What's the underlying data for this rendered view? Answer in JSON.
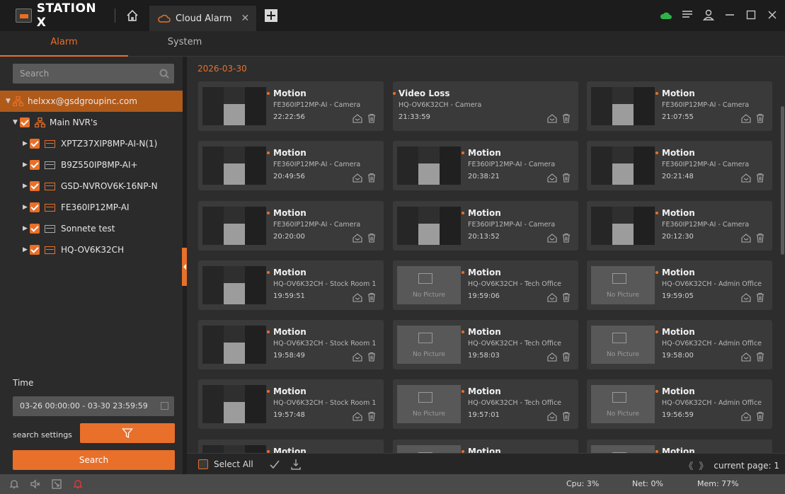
{
  "app": {
    "title": "STATION X"
  },
  "tabs": [
    {
      "label": "Cloud Alarm"
    }
  ],
  "subtabs": {
    "alarm": "Alarm",
    "system": "System"
  },
  "sidebar": {
    "search_placeholder": "Search",
    "tree": {
      "account": "helxxx@gsdgroupinc.com",
      "group": "Main NVR's",
      "devices": [
        "XPTZ37XIP8MP-AI-N(1)",
        "B9Z550IP8MP-AI+",
        "GSD-NVROV6K-16NP-N",
        "FE360IP12MP-AI",
        "Sonnete test",
        "HQ-OV6K32CH"
      ]
    },
    "time_label": "Time",
    "time_range": "03-26 00:00:00 - 03-30 23:59:59",
    "search_settings_label": "search settings",
    "search_button": "Search"
  },
  "main": {
    "date": "2026-03-30",
    "alarms": [
      {
        "type": "Motion",
        "device": "FE360IP12MP-AI - Camera",
        "time": "22:22:56",
        "picture": true
      },
      {
        "type": "Video Loss",
        "device": "HQ-OV6K32CH - Camera",
        "time": "21:33:59",
        "picture": false,
        "thumbnail": false
      },
      {
        "type": "Motion",
        "device": "FE360IP12MP-AI - Camera",
        "time": "21:07:55",
        "picture": true
      },
      {
        "type": "Motion",
        "device": "FE360IP12MP-AI - Camera",
        "time": "20:49:56",
        "picture": true
      },
      {
        "type": "Motion",
        "device": "FE360IP12MP-AI - Camera",
        "time": "20:38:21",
        "picture": true
      },
      {
        "type": "Motion",
        "device": "FE360IP12MP-AI - Camera",
        "time": "20:21:48",
        "picture": true
      },
      {
        "type": "Motion",
        "device": "FE360IP12MP-AI - Camera",
        "time": "20:20:00",
        "picture": true
      },
      {
        "type": "Motion",
        "device": "FE360IP12MP-AI - Camera",
        "time": "20:13:52",
        "picture": true
      },
      {
        "type": "Motion",
        "device": "FE360IP12MP-AI - Camera",
        "time": "20:12:30",
        "picture": true
      },
      {
        "type": "Motion",
        "device": "HQ-OV6K32CH - Stock Room 1",
        "time": "19:59:51",
        "picture": true
      },
      {
        "type": "Motion",
        "device": "HQ-OV6K32CH - Tech Office",
        "time": "19:59:06",
        "picture": false
      },
      {
        "type": "Motion",
        "device": "HQ-OV6K32CH - Admin Office",
        "time": "19:59:05",
        "picture": false
      },
      {
        "type": "Motion",
        "device": "HQ-OV6K32CH - Stock Room 1",
        "time": "19:58:49",
        "picture": true
      },
      {
        "type": "Motion",
        "device": "HQ-OV6K32CH - Tech Office",
        "time": "19:58:03",
        "picture": false
      },
      {
        "type": "Motion",
        "device": "HQ-OV6K32CH - Admin Office",
        "time": "19:58:00",
        "picture": false
      },
      {
        "type": "Motion",
        "device": "HQ-OV6K32CH - Stock Room 1",
        "time": "19:57:48",
        "picture": true
      },
      {
        "type": "Motion",
        "device": "HQ-OV6K32CH - Tech Office",
        "time": "19:57:01",
        "picture": false
      },
      {
        "type": "Motion",
        "device": "HQ-OV6K32CH - Admin Office",
        "time": "19:56:59",
        "picture": false
      },
      {
        "type": "Motion",
        "device": "",
        "time": "",
        "picture": true
      },
      {
        "type": "Motion",
        "device": "",
        "time": "",
        "picture": false
      },
      {
        "type": "Motion",
        "device": "",
        "time": "",
        "picture": false
      }
    ],
    "no_picture_text": "No Picture"
  },
  "actionbar": {
    "select_all": "Select All",
    "page_label": "current page: 1"
  },
  "status": {
    "cpu": "Cpu: 3%",
    "net": "Net: 0%",
    "mem": "Mem: 77%"
  },
  "colors": {
    "accent": "#e8702a",
    "cloud": "#2fb34a",
    "alarm_red": "#e03a3a"
  }
}
